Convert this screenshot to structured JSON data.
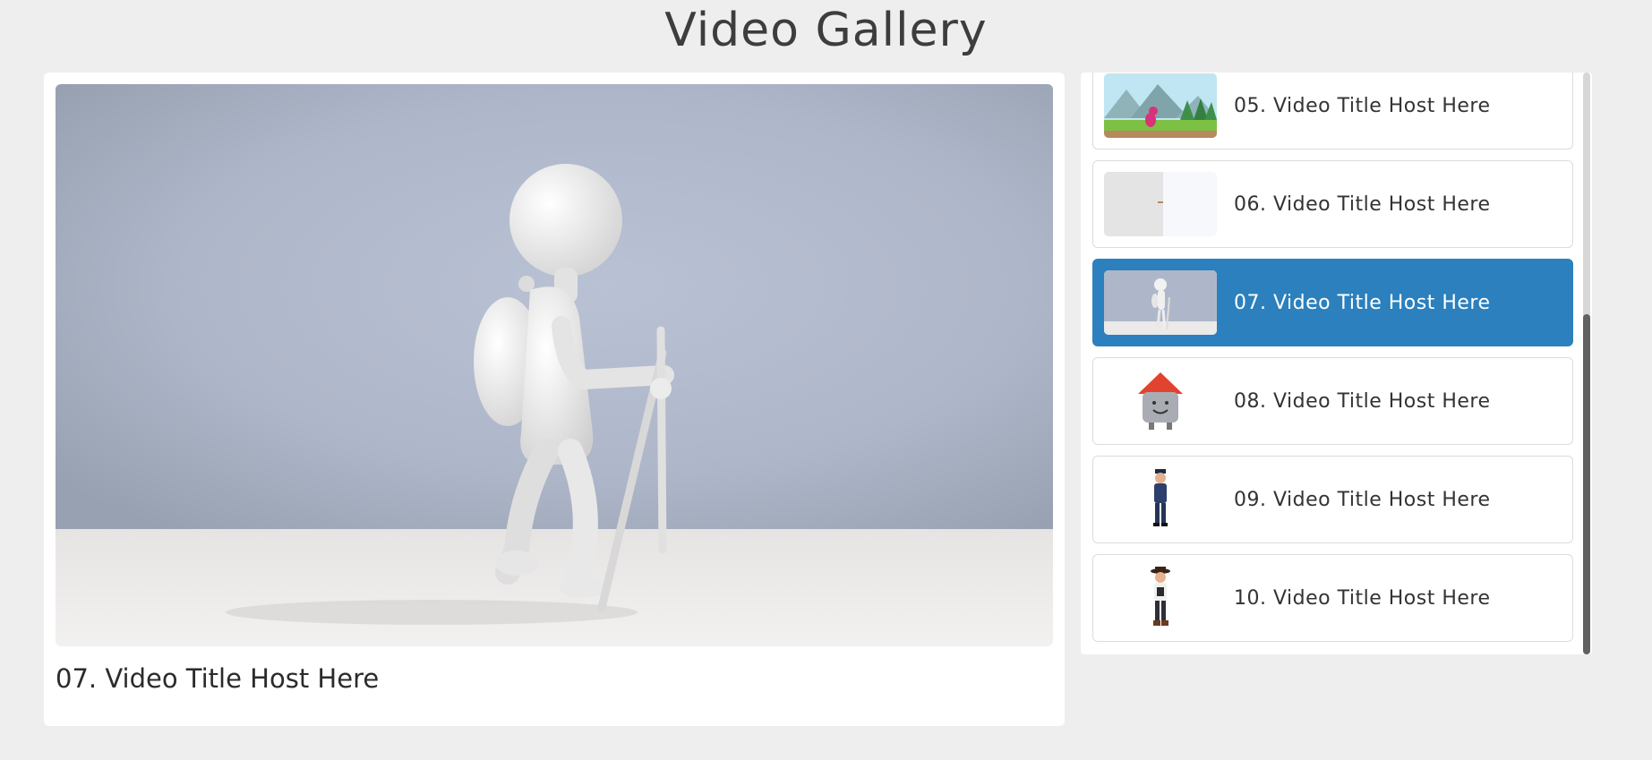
{
  "header": {
    "title": "Video Gallery"
  },
  "player": {
    "now_playing_title": "07. Video Title Host Here"
  },
  "playlist": {
    "active_index": 2,
    "items": [
      {
        "label": "05. Video Title Host Here",
        "thumb": "cartoon-forest-scene"
      },
      {
        "label": "06. Video Title Host Here",
        "thumb": "white-3d-scene"
      },
      {
        "label": "07. Video Title Host Here",
        "thumb": "3d-hiker-figure"
      },
      {
        "label": "08. Video Title Host Here",
        "thumb": "cartoon-house-character"
      },
      {
        "label": "09. Video Title Host Here",
        "thumb": "police-officer-character"
      },
      {
        "label": "10. Video Title Host Here",
        "thumb": "cowboy-character"
      }
    ]
  },
  "colors": {
    "background": "#eeeeee",
    "active_item": "#2b80bd",
    "scroll_thumb": "#616161"
  }
}
